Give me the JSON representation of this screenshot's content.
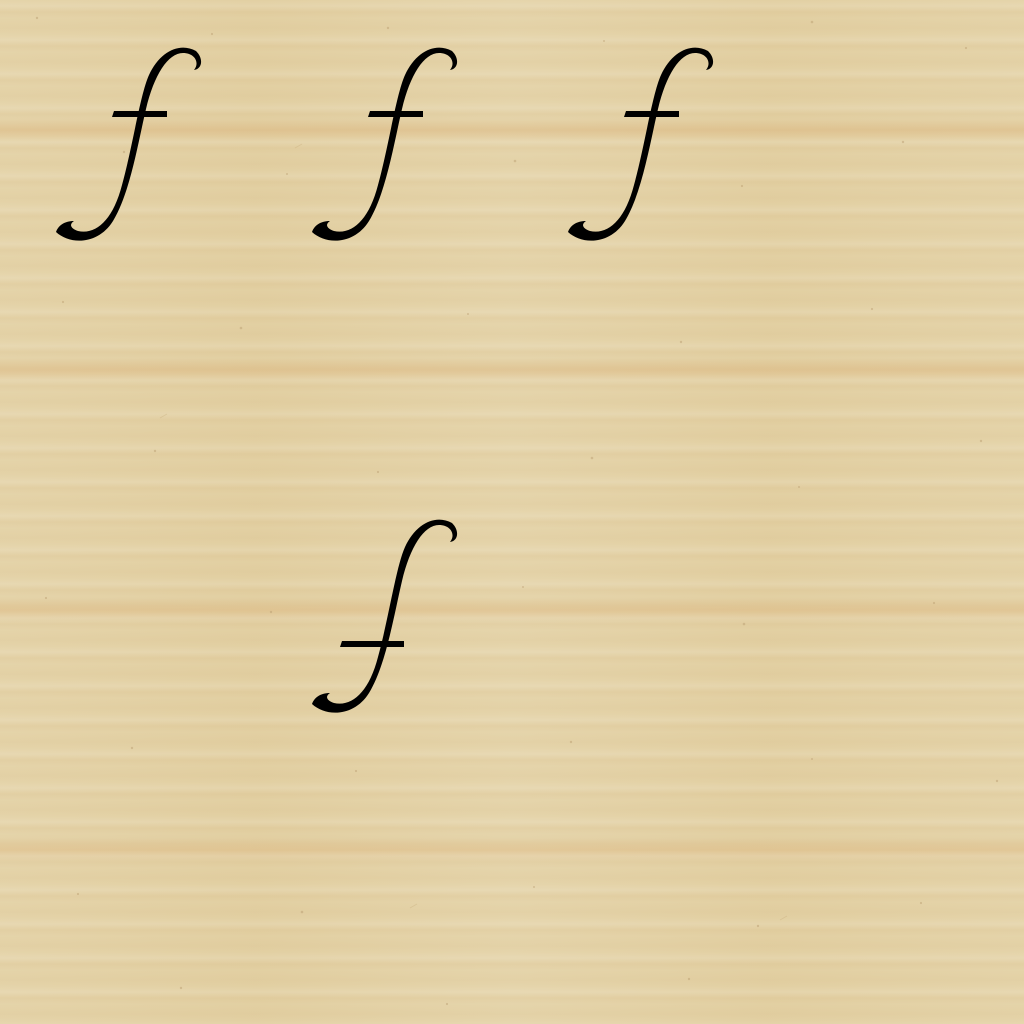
{
  "board": {
    "background": "light-wood",
    "wood_color": "#e3d1a4"
  },
  "pieces": [
    {
      "symbol": "ƒ",
      "icon": "florin-f-glyph",
      "color": "#000000"
    },
    {
      "symbol": "ƒ",
      "icon": "florin-f-glyph",
      "color": "#000000"
    },
    {
      "symbol": "ƒ",
      "icon": "florin-f-glyph",
      "color": "#000000"
    },
    {
      "symbol": "ƒ",
      "icon": "florin-f-glyph",
      "color": "#000000"
    }
  ]
}
